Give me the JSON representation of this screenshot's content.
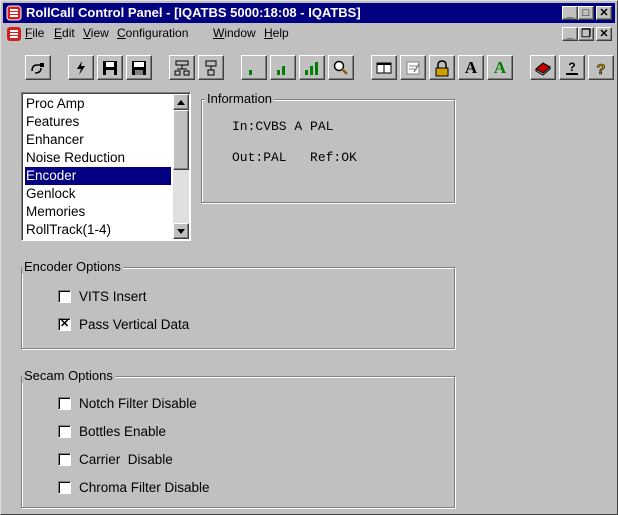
{
  "window": {
    "title": "RollCall Control Panel - [IQATBS 5000:18:08 - IQATBS]"
  },
  "caption_buttons": {
    "minimize": "_",
    "maximize": "□",
    "close": "✕"
  },
  "mdi_buttons": {
    "minimize": "_",
    "restore": "❐",
    "close": "✕"
  },
  "menu": {
    "items": [
      {
        "accel": "F",
        "rest": "ile"
      },
      {
        "accel": "E",
        "rest": "dit"
      },
      {
        "accel": "V",
        "rest": "iew"
      },
      {
        "accel": "C",
        "rest": "onfiguration"
      },
      {
        "accel": "W",
        "rest": "indow"
      },
      {
        "accel": "H",
        "rest": "elp"
      }
    ]
  },
  "toolbar": {
    "buttons": [
      "connect-icon",
      "lightning-icon",
      "save-icon",
      "save-all-icon",
      "network-icon",
      "network-single-icon",
      "signal-low-icon",
      "signal-medium-icon",
      "signal-high-icon",
      "search-icon",
      "book-icon",
      "note-icon",
      "lock-icon",
      "font-a-red-icon",
      "font-a-green-icon",
      "book-red-icon",
      "help-index-icon",
      "context-help-icon"
    ],
    "text_a": "A"
  },
  "list": {
    "items": [
      "Proc Amp",
      "Features",
      "Enhancer",
      "Noise Reduction",
      "Encoder",
      "Genlock",
      "Memories",
      "RollTrack(1-4)"
    ],
    "selected": "Encoder"
  },
  "information": {
    "label": "Information",
    "input_line": "In:CVBS A PAL",
    "output_line": "Out:PAL   Ref:OK"
  },
  "encoder_options": {
    "label": "Encoder Options",
    "items": [
      {
        "label": "VITS Insert",
        "checked": false
      },
      {
        "label": "Pass Vertical Data",
        "checked": true
      }
    ]
  },
  "secam_options": {
    "label": "Secam Options",
    "items": [
      {
        "label": "Notch Filter Disable",
        "checked": false
      },
      {
        "label": "Bottles Enable",
        "checked": false
      },
      {
        "label": "Carrier  Disable",
        "checked": false
      },
      {
        "label": "Chroma Filter Disable",
        "checked": false
      }
    ]
  },
  "colors": {
    "titlebar": "#000080",
    "selection": "#000080",
    "face": "#c0c0c0",
    "accent_red": "#c00000",
    "accent_green": "#008000"
  }
}
